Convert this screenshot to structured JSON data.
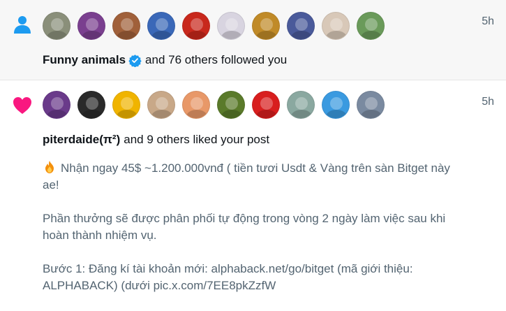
{
  "notifications": [
    {
      "kind": "follow",
      "icon": "person-icon",
      "time": "5h",
      "actor": "Funny animals",
      "actor_verified": true,
      "action": "and 76 others followed you",
      "avatars": [
        "#8a8f7a",
        "#7a3f8f",
        "#a0603a",
        "#3a68b8",
        "#c8281c",
        "#d8d4e0",
        "#c08a28",
        "#4a5a9a",
        "#d8c8b8",
        "#6a9a5a"
      ]
    },
    {
      "kind": "like",
      "icon": "heart-icon",
      "time": "5h",
      "actor": "piterdaide(π²)",
      "action": "and 9 others liked your post",
      "avatars": [
        "#6a3a8a",
        "#2a2a2a",
        "#f0b400",
        "#c8a888",
        "#e89868",
        "#5a7a2a",
        "#d81e1e",
        "#8aa8a0",
        "#3a9ae0",
        "#7a8aa0"
      ],
      "post": {
        "line1": "Nhận ngay 45$ ~1.200.000vnđ ( tiền tươi Usdt & Vàng trên sàn Bitget này ae!",
        "line2": "Phần thưởng sẽ được phân phối tự động trong vòng 2 ngày làm việc sau khi hoàn thành nhiệm vụ.",
        "line3": "Bước 1: Đăng kí tài khoản mới: alphaback.net/go/bitget (mã giới thiệu: ALPHABACK) (dưới pic.x.com/7EE8pkZzfW"
      }
    }
  ],
  "colors": {
    "follow_icon": "#1d9bf0",
    "like_icon": "#f91880",
    "verified": "#1d9bf0",
    "secondary_text": "#536471"
  }
}
